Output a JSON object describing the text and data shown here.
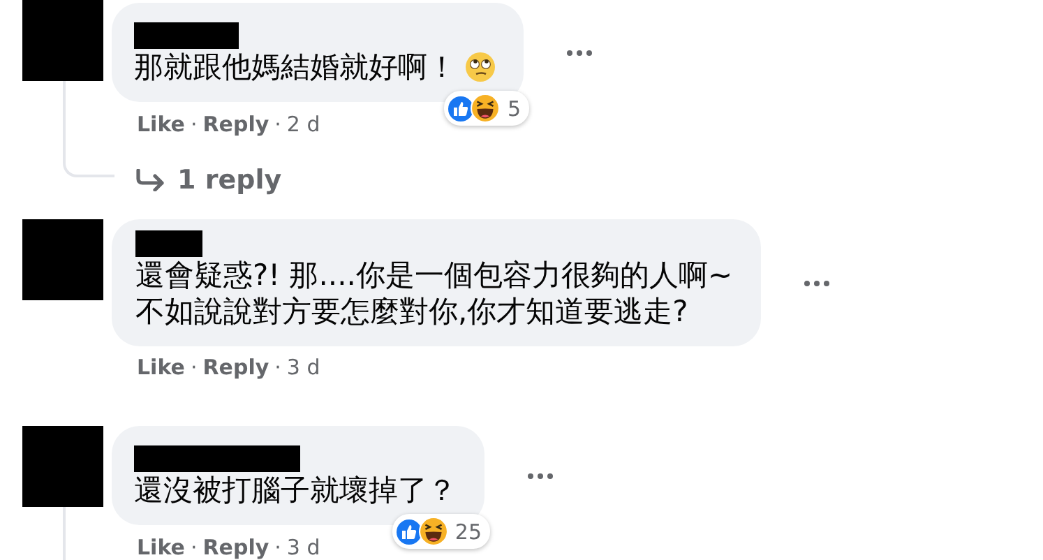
{
  "comments": [
    {
      "lines": [
        "那就跟他媽結婚就好啊！"
      ],
      "inline_emoji": true,
      "reactions": {
        "count": "5"
      },
      "like_label": "Like",
      "reply_label": "Reply",
      "separator": "·",
      "time": "2 d",
      "reply_thread": true,
      "replies_link": "1 reply"
    },
    {
      "lines": [
        "還會疑惑?! 那....你是一個包容力很夠的人啊~",
        "不如說說對方要怎麼對你,你才知道要逃走?"
      ],
      "like_label": "Like",
      "reply_label": "Reply",
      "separator": "·",
      "time": "3 d",
      "reply_thread": false
    },
    {
      "lines": [
        "還沒被打腦子就壞掉了？"
      ],
      "reactions": {
        "count": "25"
      },
      "like_label": "Like",
      "reply_label": "Reply",
      "separator": "·",
      "time": "3 d",
      "reply_thread": true
    }
  ]
}
